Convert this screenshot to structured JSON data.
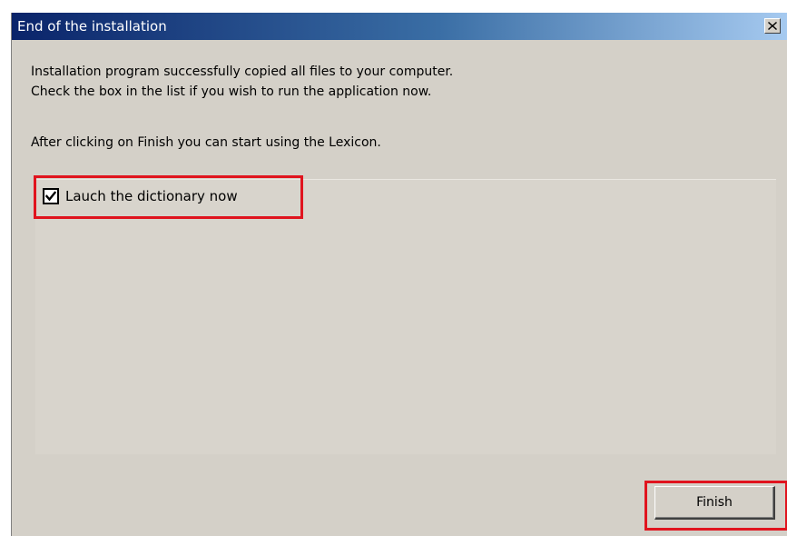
{
  "window": {
    "title": "End of the installation",
    "close_icon": "close-icon"
  },
  "content": {
    "message_line_1": "Installation program successfully copied all files to your computer.",
    "message_line_2": "Check the box in the list if you wish to run the application now.",
    "message_line_3": "After clicking on Finish you can start using the Lexicon."
  },
  "options": {
    "launch_label": "Lauch the dictionary now",
    "launch_checked": true
  },
  "buttons": {
    "finish_label": "Finish"
  },
  "colors": {
    "titlebar_start": "#0a246a",
    "titlebar_end": "#a6caf0",
    "dialog_bg": "#d4d0c8",
    "highlight": "#e0141e"
  }
}
